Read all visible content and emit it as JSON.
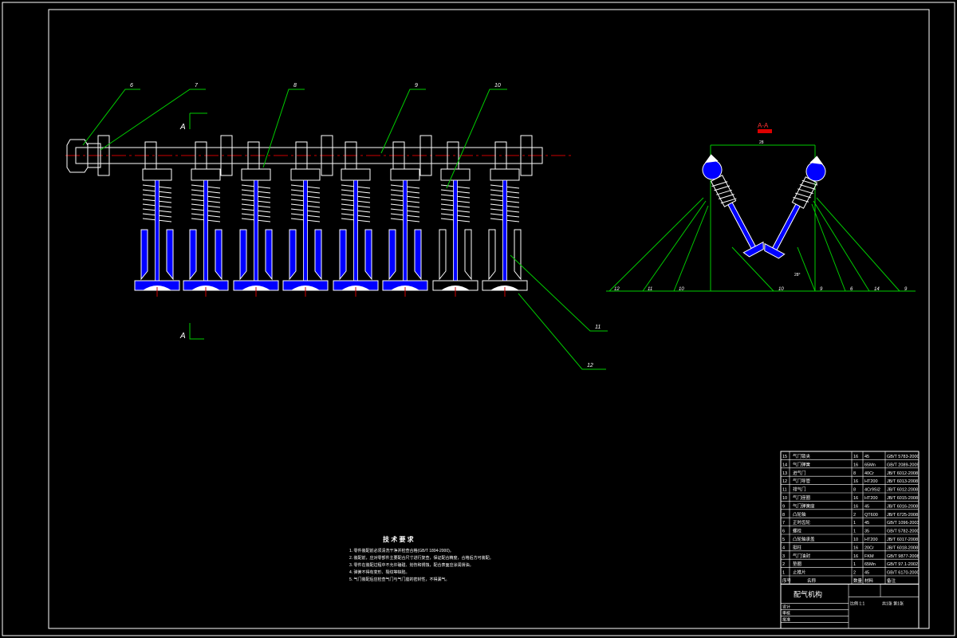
{
  "colors": {
    "background": "#000000",
    "border": "#ffffff",
    "leader": "#00cc00",
    "centerline": "#cc0000",
    "part_blue": "#0000ff",
    "part_white": "#ffffff",
    "tag_red": "#dd0000"
  },
  "section_marks": {
    "top": "A",
    "bottom": "A",
    "title": "A-A"
  },
  "balloons_main": [
    "6",
    "7",
    "8",
    "9",
    "10",
    "11",
    "12"
  ],
  "balloons_section": [
    "12",
    "11",
    "10",
    "10",
    "9",
    "6",
    "14",
    "9"
  ],
  "dimensions": {
    "top_width": "28",
    "angle": "28°"
  },
  "tech_requirements": {
    "title": "技 术 要 求",
    "items": [
      "1. 零件装配前必须清洗干净并检查合格(GB/T 1804-2000)。",
      "2. 装配前，应对零部件主要配合尺寸进行复查，保证配合精度，合格后方可装配。",
      "3. 零件在装配过程中不允许磕碰、划伤和锈蚀，配合表面应涂润滑油。",
      "4. 弹簧不得有变形、裂纹等缺陷。",
      "5. 气门装配后应检查气门与气门座的密封性，不得漏气。"
    ]
  },
  "bom": {
    "rows": [
      {
        "no": "15",
        "name": "气门锁夹",
        "qty": "16",
        "mat": "45",
        "std": "GB/T 5783-2000"
      },
      {
        "no": "14",
        "name": "气门弹簧",
        "qty": "16",
        "mat": "65Mn",
        "std": "GB/T 2089-2009"
      },
      {
        "no": "13",
        "name": "进气门",
        "qty": "8",
        "mat": "40Cr",
        "std": "JB/T 6012-2008"
      },
      {
        "no": "12",
        "name": "气门导管",
        "qty": "16",
        "mat": "HT200",
        "std": "JB/T 6013-2008"
      },
      {
        "no": "11",
        "name": "排气门",
        "qty": "8",
        "mat": "4Cr9Si2",
        "std": "JB/T 6012-2008"
      },
      {
        "no": "10",
        "name": "气门座圈",
        "qty": "16",
        "mat": "HT200",
        "std": "JB/T 6015-2008"
      },
      {
        "no": "9",
        "name": "气门弹簧座",
        "qty": "16",
        "mat": "45",
        "std": "JB/T 6016-2008"
      },
      {
        "no": "8",
        "name": "凸轮轴",
        "qty": "2",
        "mat": "QT600",
        "std": "JB/T 6725-2008"
      },
      {
        "no": "7",
        "name": "正时齿轮",
        "qty": "1",
        "mat": "45",
        "std": "GB/T 1096-2003"
      },
      {
        "no": "6",
        "name": "螺栓",
        "qty": "1",
        "mat": "35",
        "std": "GB/T 5782-2000"
      },
      {
        "no": "5",
        "name": "凸轮轴承盖",
        "qty": "10",
        "mat": "HT200",
        "std": "JB/T 6017-2008"
      },
      {
        "no": "4",
        "name": "挺柱",
        "qty": "16",
        "mat": "20Cr",
        "std": "JB/T 6018-2008"
      },
      {
        "no": "3",
        "name": "气门油封",
        "qty": "16",
        "mat": "FKM",
        "std": "GB/T 9877-2008"
      },
      {
        "no": "2",
        "name": "垫圈",
        "qty": "1",
        "mat": "65Mn",
        "std": "GB/T 97.1-2002"
      },
      {
        "no": "1",
        "name": "止推片",
        "qty": "2",
        "mat": "45",
        "std": "GB/T 6170-2000"
      }
    ],
    "header": {
      "no": "序号",
      "name": "名称",
      "qty": "数量",
      "mat": "材料",
      "std": "备注"
    },
    "title_block": {
      "drawing_name": "配气机构",
      "scale": "比例 1:1",
      "sheet": "共1张 第1张",
      "design_label": "设计",
      "check_label": "审核",
      "approve_label": "批准"
    }
  }
}
